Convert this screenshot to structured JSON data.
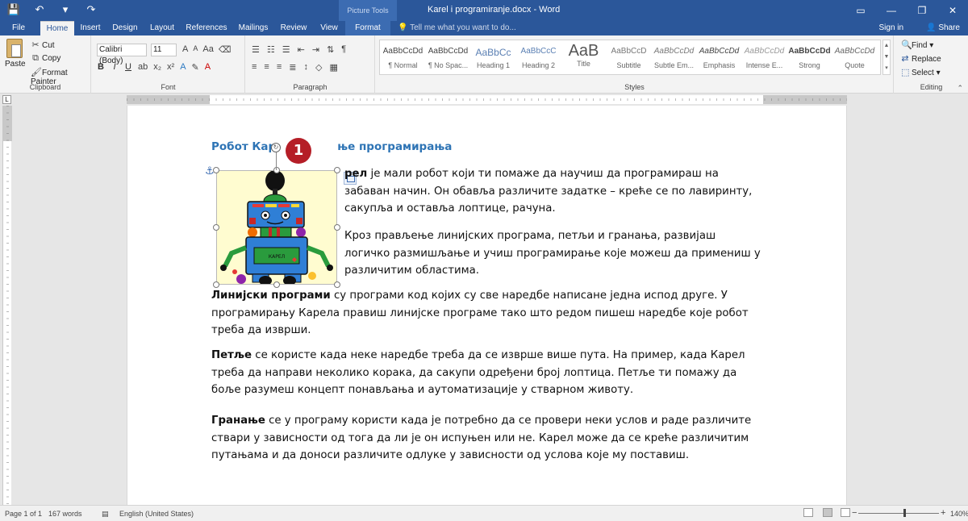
{
  "window": {
    "title": "Karel i programiranje.docx - Word",
    "context_tab": "Picture Tools",
    "controls": [
      "▭",
      "—",
      "❐",
      "✕"
    ]
  },
  "quick_access": [
    "💾",
    "↶",
    "▾",
    "↷"
  ],
  "tabs": {
    "items": [
      "File",
      "Home",
      "Insert",
      "Design",
      "Layout",
      "References",
      "Mailings",
      "Review",
      "View",
      "Format"
    ],
    "tell_me": "Tell me what you want to do...",
    "signin": "Sign in",
    "share": "Share"
  },
  "ribbon": {
    "clipboard": {
      "label": "Clipboard",
      "paste": "Paste",
      "cut": "Cut",
      "copy": "Copy",
      "format_painter": "Format Painter"
    },
    "font": {
      "label": "Font",
      "name": "Calibri (Body)",
      "size": "11",
      "bold": "B",
      "italic": "I",
      "underline": "U"
    },
    "paragraph": {
      "label": "Paragraph",
      "pilcrow": "¶"
    },
    "styles": {
      "label": "Styles",
      "items": [
        {
          "sample": "AaBbCcDd",
          "name": "¶ Normal"
        },
        {
          "sample": "AaBbCcDd",
          "name": "¶ No Spac..."
        },
        {
          "sample": "AaBbCc",
          "name": "Heading 1"
        },
        {
          "sample": "AaBbCcC",
          "name": "Heading 2"
        },
        {
          "sample": "AaB",
          "name": "Title"
        },
        {
          "sample": "AaBbCcD",
          "name": "Subtitle"
        },
        {
          "sample": "AaBbCcDd",
          "name": "Subtle Em..."
        },
        {
          "sample": "AaBbCcDd",
          "name": "Emphasis"
        },
        {
          "sample": "AaBbCcDd",
          "name": "Intense E..."
        },
        {
          "sample": "AaBbCcDd",
          "name": "Strong"
        },
        {
          "sample": "AaBbCcDd",
          "name": "Quote"
        }
      ]
    },
    "editing": {
      "label": "Editing",
      "find": "Find",
      "replace": "Replace",
      "select": "Select"
    }
  },
  "document": {
    "heading_a": "Робот Кар",
    "heading_b": "ње програмирања",
    "p1_bold": "рел",
    "p1_text": " је мали робот који ти помаже да научиш да програмираш на забаван начин. Он обавља различите задатке – креће се по лавиринту, сакупља и оставља лоптице, рачуна.",
    "p2_text": "Кроз прављење линијских програма, петљи и гранања, развијаш логичко размишљање и учиш програмирање које можеш да примениш у различитим областима.",
    "p3_bold": "Линијски програми",
    "p3_text": " су програми код којих су све наредбе написане једна испод друге. У програмирању Карела правиш линијске програме тако што редом пишеш наредбе које робот треба да изврши.",
    "p4_bold": "Петље",
    "p4_text": " се користе када неке наредбе треба да се изврше више пута. На пример, када Карел треба да направи неколико корака, да сакупи одређени број лоптица. Петље ти помажу да боље разумеш концепт понављања и аутоматизације у стварном животу.",
    "p5_bold": "Гранање",
    "p5_text": " се у програму користи када је потребно да се провери неки услов и раде различите ствари у зависности од тога да ли је он испуњен или не. Карел може да се креће различитим путањама и да доноси различите одлуке у зависности од услова које му поставиш.",
    "robot_label": "КАРЕЛ",
    "callout_number": "1"
  },
  "status": {
    "page": "Page 1 of 1",
    "words": "167 words",
    "language": "English (United States)",
    "zoom": "140%"
  },
  "colors": {
    "accent": "#2b579a",
    "heading": "#2e74b5",
    "callout": "#b51e27"
  }
}
